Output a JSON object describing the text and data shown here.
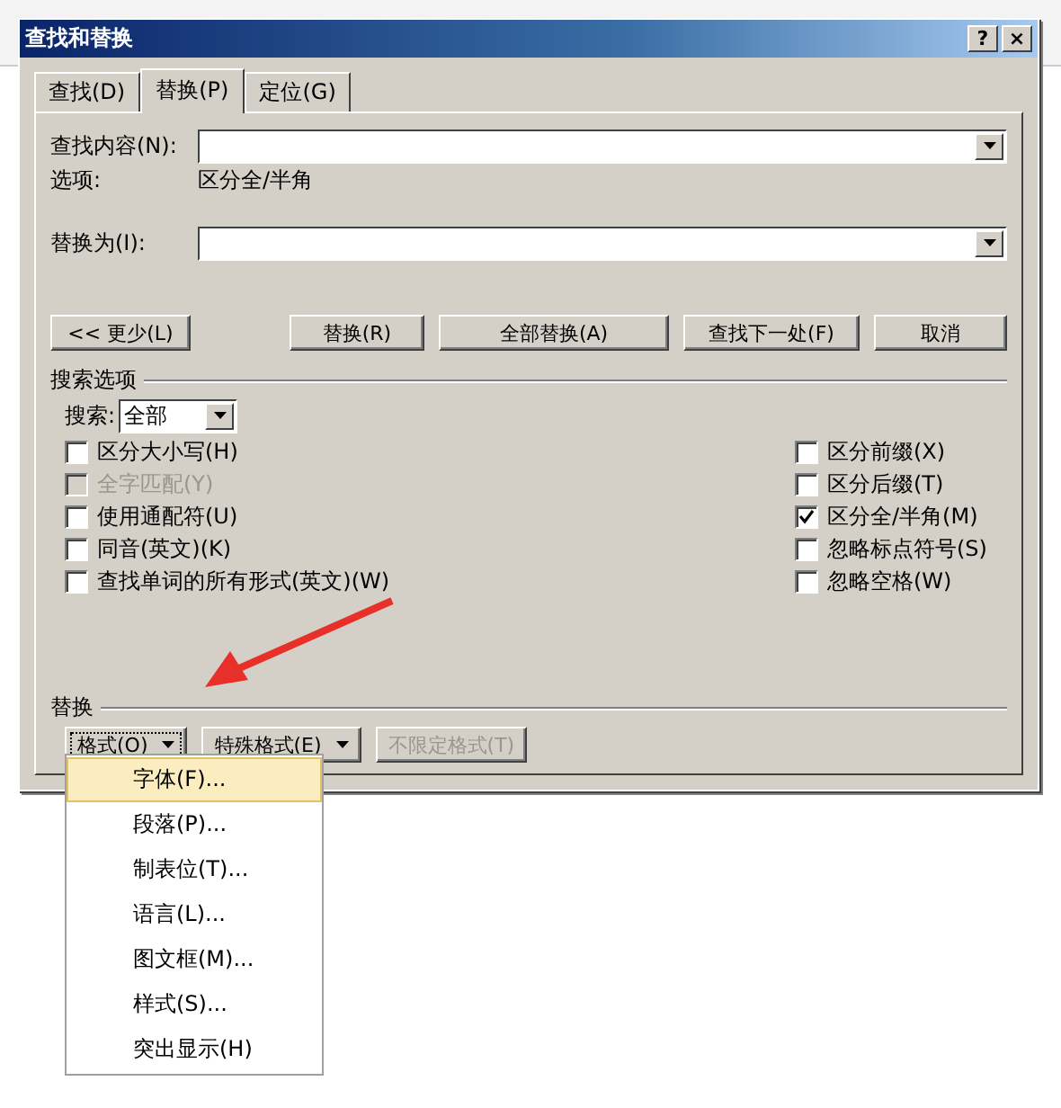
{
  "window": {
    "title": "查找和替换",
    "help_button": "?",
    "close_button": "×"
  },
  "tabs": [
    {
      "label": "查找(D)",
      "selected": false
    },
    {
      "label": "替换(P)",
      "selected": true
    },
    {
      "label": "定位(G)",
      "selected": false
    }
  ],
  "find": {
    "label": "查找内容(N):"
  },
  "options": {
    "label": "选项:",
    "value": "区分全/半角"
  },
  "replace": {
    "label": "替换为(I):"
  },
  "buttons": [
    {
      "label": "<< 更少(L)",
      "kind": "left"
    },
    {
      "label": "替换(R)",
      "kind": "right"
    },
    {
      "label": "全部替换(A)",
      "kind": "right"
    },
    {
      "label": "查找下一处(F)",
      "kind": "right"
    },
    {
      "label": "取消",
      "kind": "right"
    }
  ],
  "search_options": {
    "legend": "搜索选项",
    "search_label": "搜索:",
    "search_value": "全部",
    "left": [
      {
        "label": "区分大小写(H)",
        "checked": false,
        "disabled": false
      },
      {
        "label": "全字匹配(Y)",
        "checked": false,
        "disabled": true
      },
      {
        "label": "使用通配符(U)",
        "checked": false,
        "disabled": false
      },
      {
        "label": "同音(英文)(K)",
        "checked": false,
        "disabled": false
      },
      {
        "label": "查找单词的所有形式(英文)(W)",
        "checked": false,
        "disabled": false
      }
    ],
    "right": [
      {
        "label": "区分前缀(X)",
        "checked": false,
        "disabled": false
      },
      {
        "label": "区分后缀(T)",
        "checked": false,
        "disabled": false
      },
      {
        "label": "区分全/半角(M)",
        "checked": true,
        "disabled": false
      },
      {
        "label": "忽略标点符号(S)",
        "checked": false,
        "disabled": false
      },
      {
        "label": "忽略空格(W)",
        "checked": false,
        "disabled": false
      }
    ]
  },
  "replace_section": {
    "legend": "替换",
    "buttons": [
      {
        "label": "格式(O)",
        "dropdown": true,
        "disabled": false,
        "open": true
      },
      {
        "label": "特殊格式(E)",
        "dropdown": true,
        "disabled": false,
        "open": false
      },
      {
        "label": "不限定格式(T)",
        "dropdown": false,
        "disabled": true,
        "open": false
      }
    ]
  },
  "menu": [
    {
      "label": "字体(F)...",
      "selected": true
    },
    {
      "label": "段落(P)...",
      "selected": false
    },
    {
      "label": "制表位(T)...",
      "selected": false
    },
    {
      "label": "语言(L)...",
      "selected": false
    },
    {
      "label": "图文框(M)...",
      "selected": false
    },
    {
      "label": "样式(S)...",
      "selected": false
    },
    {
      "label": "突出显示(H)",
      "selected": false
    }
  ]
}
